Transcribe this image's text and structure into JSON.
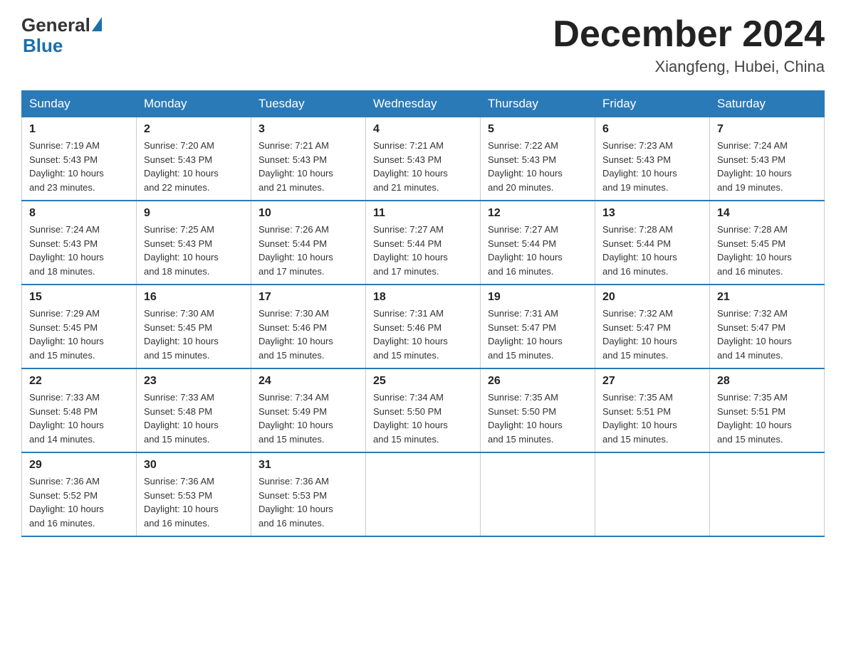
{
  "logo": {
    "general": "General",
    "blue": "Blue"
  },
  "title": "December 2024",
  "location": "Xiangfeng, Hubei, China",
  "headers": [
    "Sunday",
    "Monday",
    "Tuesday",
    "Wednesday",
    "Thursday",
    "Friday",
    "Saturday"
  ],
  "weeks": [
    [
      {
        "day": "1",
        "sunrise": "7:19 AM",
        "sunset": "5:43 PM",
        "daylight": "10 hours and 23 minutes."
      },
      {
        "day": "2",
        "sunrise": "7:20 AM",
        "sunset": "5:43 PM",
        "daylight": "10 hours and 22 minutes."
      },
      {
        "day": "3",
        "sunrise": "7:21 AM",
        "sunset": "5:43 PM",
        "daylight": "10 hours and 21 minutes."
      },
      {
        "day": "4",
        "sunrise": "7:21 AM",
        "sunset": "5:43 PM",
        "daylight": "10 hours and 21 minutes."
      },
      {
        "day": "5",
        "sunrise": "7:22 AM",
        "sunset": "5:43 PM",
        "daylight": "10 hours and 20 minutes."
      },
      {
        "day": "6",
        "sunrise": "7:23 AM",
        "sunset": "5:43 PM",
        "daylight": "10 hours and 19 minutes."
      },
      {
        "day": "7",
        "sunrise": "7:24 AM",
        "sunset": "5:43 PM",
        "daylight": "10 hours and 19 minutes."
      }
    ],
    [
      {
        "day": "8",
        "sunrise": "7:24 AM",
        "sunset": "5:43 PM",
        "daylight": "10 hours and 18 minutes."
      },
      {
        "day": "9",
        "sunrise": "7:25 AM",
        "sunset": "5:43 PM",
        "daylight": "10 hours and 18 minutes."
      },
      {
        "day": "10",
        "sunrise": "7:26 AM",
        "sunset": "5:44 PM",
        "daylight": "10 hours and 17 minutes."
      },
      {
        "day": "11",
        "sunrise": "7:27 AM",
        "sunset": "5:44 PM",
        "daylight": "10 hours and 17 minutes."
      },
      {
        "day": "12",
        "sunrise": "7:27 AM",
        "sunset": "5:44 PM",
        "daylight": "10 hours and 16 minutes."
      },
      {
        "day": "13",
        "sunrise": "7:28 AM",
        "sunset": "5:44 PM",
        "daylight": "10 hours and 16 minutes."
      },
      {
        "day": "14",
        "sunrise": "7:28 AM",
        "sunset": "5:45 PM",
        "daylight": "10 hours and 16 minutes."
      }
    ],
    [
      {
        "day": "15",
        "sunrise": "7:29 AM",
        "sunset": "5:45 PM",
        "daylight": "10 hours and 15 minutes."
      },
      {
        "day": "16",
        "sunrise": "7:30 AM",
        "sunset": "5:45 PM",
        "daylight": "10 hours and 15 minutes."
      },
      {
        "day": "17",
        "sunrise": "7:30 AM",
        "sunset": "5:46 PM",
        "daylight": "10 hours and 15 minutes."
      },
      {
        "day": "18",
        "sunrise": "7:31 AM",
        "sunset": "5:46 PM",
        "daylight": "10 hours and 15 minutes."
      },
      {
        "day": "19",
        "sunrise": "7:31 AM",
        "sunset": "5:47 PM",
        "daylight": "10 hours and 15 minutes."
      },
      {
        "day": "20",
        "sunrise": "7:32 AM",
        "sunset": "5:47 PM",
        "daylight": "10 hours and 15 minutes."
      },
      {
        "day": "21",
        "sunrise": "7:32 AM",
        "sunset": "5:47 PM",
        "daylight": "10 hours and 14 minutes."
      }
    ],
    [
      {
        "day": "22",
        "sunrise": "7:33 AM",
        "sunset": "5:48 PM",
        "daylight": "10 hours and 14 minutes."
      },
      {
        "day": "23",
        "sunrise": "7:33 AM",
        "sunset": "5:48 PM",
        "daylight": "10 hours and 15 minutes."
      },
      {
        "day": "24",
        "sunrise": "7:34 AM",
        "sunset": "5:49 PM",
        "daylight": "10 hours and 15 minutes."
      },
      {
        "day": "25",
        "sunrise": "7:34 AM",
        "sunset": "5:50 PM",
        "daylight": "10 hours and 15 minutes."
      },
      {
        "day": "26",
        "sunrise": "7:35 AM",
        "sunset": "5:50 PM",
        "daylight": "10 hours and 15 minutes."
      },
      {
        "day": "27",
        "sunrise": "7:35 AM",
        "sunset": "5:51 PM",
        "daylight": "10 hours and 15 minutes."
      },
      {
        "day": "28",
        "sunrise": "7:35 AM",
        "sunset": "5:51 PM",
        "daylight": "10 hours and 15 minutes."
      }
    ],
    [
      {
        "day": "29",
        "sunrise": "7:36 AM",
        "sunset": "5:52 PM",
        "daylight": "10 hours and 16 minutes."
      },
      {
        "day": "30",
        "sunrise": "7:36 AM",
        "sunset": "5:53 PM",
        "daylight": "10 hours and 16 minutes."
      },
      {
        "day": "31",
        "sunrise": "7:36 AM",
        "sunset": "5:53 PM",
        "daylight": "10 hours and 16 minutes."
      },
      null,
      null,
      null,
      null
    ]
  ],
  "labels": {
    "sunrise": "Sunrise:",
    "sunset": "Sunset:",
    "daylight": "Daylight:"
  }
}
